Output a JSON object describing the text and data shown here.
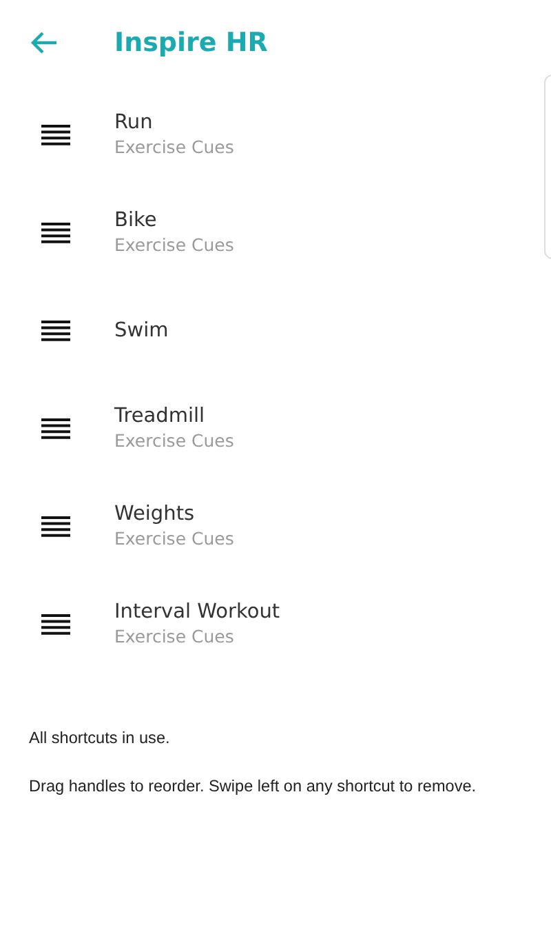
{
  "header": {
    "title": "Inspire HR"
  },
  "shortcuts": [
    {
      "title": "Run",
      "subtitle": "Exercise Cues"
    },
    {
      "title": "Bike",
      "subtitle": "Exercise Cues"
    },
    {
      "title": "Swim"
    },
    {
      "title": "Treadmill",
      "subtitle": "Exercise Cues"
    },
    {
      "title": "Weights",
      "subtitle": "Exercise Cues"
    },
    {
      "title": "Interval Workout",
      "subtitle": "Exercise Cues"
    }
  ],
  "status": "All shortcuts in use.",
  "hint": "Drag handles to reorder. Swipe left on any shortcut to remove."
}
